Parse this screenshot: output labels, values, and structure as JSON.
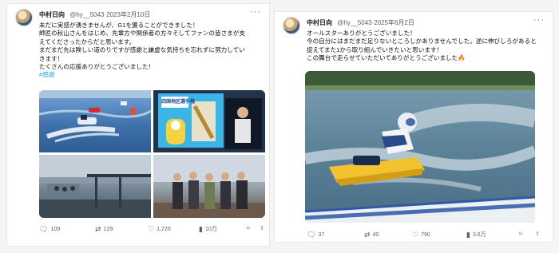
{
  "post1": {
    "author": "中村日向",
    "handle": "@hy__5043",
    "date": "2023年2月10日",
    "lines": [
      "未だに実感が湧きませんが、G1を獲ることができました！",
      "師匠の秋山さんをはじめ、先輩方や関係者の方々そしてファンの皆さまが支",
      "えてくださったからだと思います。",
      "まだまだ先は険しい道のりですが感謝と謙虚な気持ちを忘れずに努力してい",
      "きます！",
      "たくさんの応援ありがとうございました！"
    ],
    "hashtag": "#感謝",
    "banner_text": "四国地区選手権",
    "stats": {
      "replies": "109",
      "reposts": "129",
      "likes": "1,720",
      "views": "10万"
    }
  },
  "post2": {
    "author": "中村日向",
    "handle": "@hy__5043",
    "date": "2025年6月2日",
    "lines": [
      "オールスターありがとうございました！",
      "今の自分にはまだまだ足りないところしかありませんでした。逆に伸びしろがあると",
      "捉えてまた1から取り組んでいきたいと思います！",
      "この舞台で走らせていただいてありがとうございました🔥"
    ],
    "stats": {
      "replies": "37",
      "reposts": "40",
      "likes": "790",
      "views": "3.6万"
    }
  },
  "colors": {
    "accent": "#1d9bf0",
    "text": "#0f1419",
    "muted": "#536471"
  }
}
